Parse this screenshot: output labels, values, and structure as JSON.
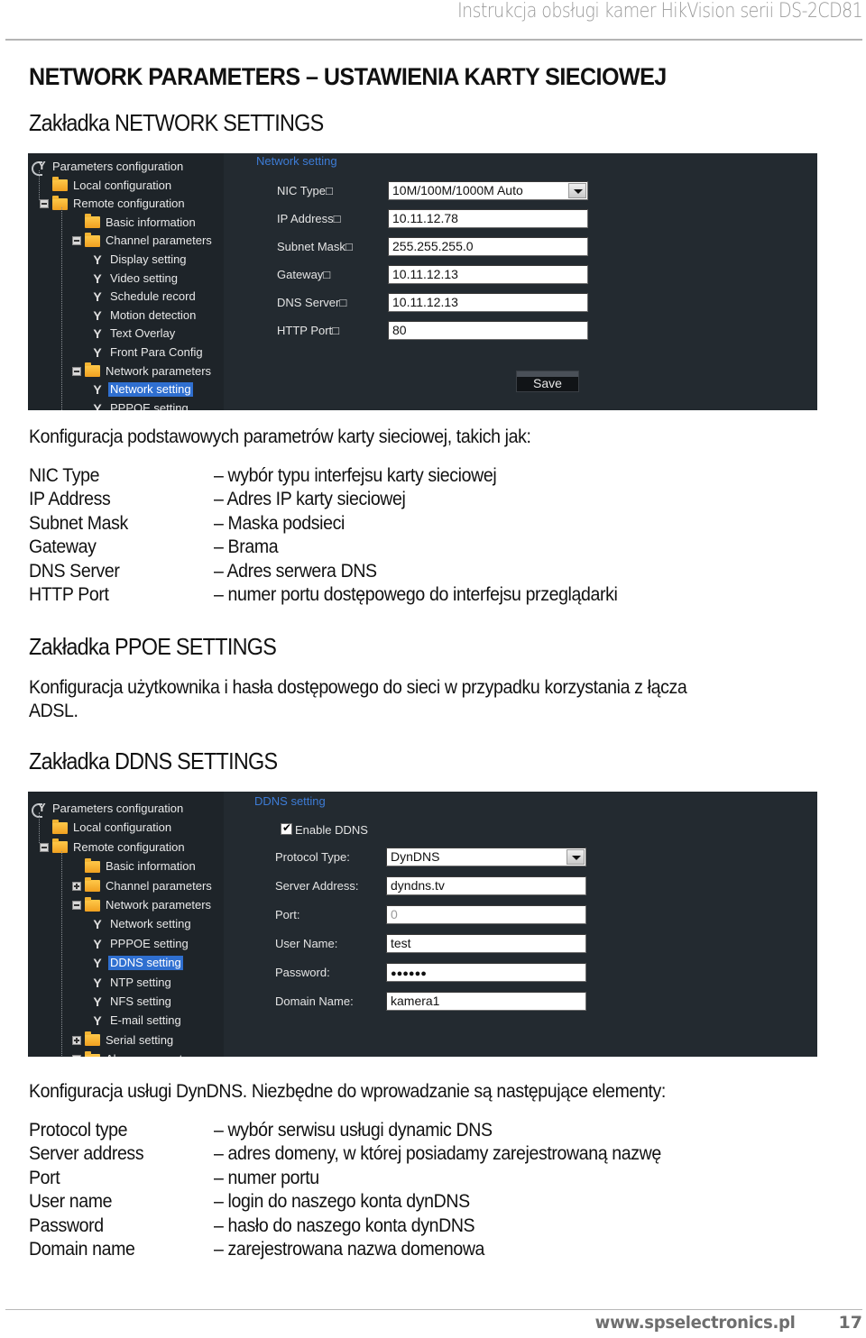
{
  "running_header": "Instrukcja obsługi kamer HikVision serii DS-2CD81",
  "title": "NETWORK PARAMETERS – USTAWIENIA KARTY SIECIOWEJ",
  "network_section": {
    "heading": "Zakładka NETWORK SETTINGS",
    "screenshot": {
      "tree": [
        {
          "label": "Parameters configuration",
          "icon": "root-config-icon",
          "level": 0
        },
        {
          "label": "Local configuration",
          "icon": "folder-icon",
          "level": 1
        },
        {
          "label": "Remote configuration",
          "icon": "folder-icon",
          "level": 1,
          "expander": "collapse"
        },
        {
          "label": "Basic information",
          "icon": "folder-icon",
          "level": 2
        },
        {
          "label": "Channel parameters",
          "icon": "folder-icon",
          "level": 2,
          "expander": "collapse"
        },
        {
          "label": "Display setting",
          "icon": "wrench-icon",
          "level": 3
        },
        {
          "label": "Video setting",
          "icon": "wrench-icon",
          "level": 3
        },
        {
          "label": "Schedule record",
          "icon": "wrench-icon",
          "level": 3
        },
        {
          "label": "Motion detection",
          "icon": "wrench-icon",
          "level": 3
        },
        {
          "label": "Text Overlay",
          "icon": "wrench-icon",
          "level": 3
        },
        {
          "label": "Front Para Config",
          "icon": "wrench-icon",
          "level": 3
        },
        {
          "label": "Network parameters",
          "icon": "folder-icon",
          "level": 2,
          "expander": "collapse"
        },
        {
          "label": "Network setting",
          "icon": "wrench-icon",
          "level": 3,
          "selected": true
        },
        {
          "label": "PPPOE setting",
          "icon": "wrench-icon",
          "level": 3
        }
      ],
      "panel_title": "Network setting",
      "fields": [
        {
          "label": "NIC Type□",
          "value": "10M/100M/1000M Auto",
          "type": "select"
        },
        {
          "label": "IP Address□",
          "value": "10.11.12.78",
          "type": "text"
        },
        {
          "label": "Subnet Mask□",
          "value": "255.255.255.0",
          "type": "text"
        },
        {
          "label": "Gateway□",
          "value": "10.11.12.13",
          "type": "text"
        },
        {
          "label": "DNS Server□",
          "value": "10.11.12.13",
          "type": "text"
        },
        {
          "label": "HTTP Port□",
          "value": "80",
          "type": "text"
        }
      ],
      "save_label": "Save"
    },
    "intro": "Konfiguracja podstawowych parametrów karty sieciowej, takich jak:",
    "definitions": [
      {
        "term": "NIC Type",
        "desc": "– wybór typu interfejsu karty sieciowej"
      },
      {
        "term": "IP Address",
        "desc": "– Adres IP karty sieciowej"
      },
      {
        "term": "Subnet Mask",
        "desc": "– Maska podsieci"
      },
      {
        "term": "Gateway",
        "desc": "– Brama"
      },
      {
        "term": "DNS Server",
        "desc": "– Adres serwera DNS"
      },
      {
        "term": "HTTP Port",
        "desc": "– numer portu dostępowego do interfejsu przeglądarki"
      }
    ]
  },
  "ppoe_section": {
    "heading": "Zakładka PPOE SETTINGS",
    "text_line1": "Konfiguracja użytkownika i hasła dostępowego do sieci w przypadku korzystania z łącza",
    "text_line2": "ADSL."
  },
  "ddns_section": {
    "heading": "Zakładka DDNS SETTINGS",
    "screenshot": {
      "tree": [
        {
          "label": "Parameters configuration",
          "icon": "root-config-icon",
          "level": 0
        },
        {
          "label": "Local configuration",
          "icon": "folder-icon",
          "level": 1
        },
        {
          "label": "Remote configuration",
          "icon": "folder-icon",
          "level": 1,
          "expander": "collapse"
        },
        {
          "label": "Basic information",
          "icon": "folder-icon",
          "level": 2
        },
        {
          "label": "Channel parameters",
          "icon": "folder-icon",
          "level": 2,
          "expander": "expand"
        },
        {
          "label": "Network parameters",
          "icon": "folder-icon",
          "level": 2,
          "expander": "collapse"
        },
        {
          "label": "Network setting",
          "icon": "wrench-icon",
          "level": 3
        },
        {
          "label": "PPPOE setting",
          "icon": "wrench-icon",
          "level": 3
        },
        {
          "label": "DDNS setting",
          "icon": "wrench-icon",
          "level": 3,
          "selected": true
        },
        {
          "label": "NTP setting",
          "icon": "wrench-icon",
          "level": 3
        },
        {
          "label": "NFS setting",
          "icon": "wrench-icon",
          "level": 3
        },
        {
          "label": "E-mail setting",
          "icon": "wrench-icon",
          "level": 3
        },
        {
          "label": "Serial setting",
          "icon": "folder-icon",
          "level": 2,
          "expander": "expand"
        },
        {
          "label": "Alarm parameters",
          "icon": "folder-icon",
          "level": 2,
          "expander": "expand"
        }
      ],
      "panel_title": "DDNS setting",
      "enable_label": "Enable DDNS",
      "enable_checked": true,
      "fields": [
        {
          "label": "Protocol Type:",
          "value": "DynDNS",
          "type": "select"
        },
        {
          "label": "Server Address:",
          "value": "dyndns.tv",
          "type": "text"
        },
        {
          "label": "Port:",
          "value": "0",
          "type": "text",
          "disabled": true
        },
        {
          "label": "User Name:",
          "value": "test",
          "type": "text"
        },
        {
          "label": "Password:",
          "value": "●●●●●●",
          "type": "password"
        },
        {
          "label": "Domain Name:",
          "value": "kamera1",
          "type": "text"
        }
      ]
    },
    "intro": "Konfiguracja usługi DynDNS. Niezbędne do wprowadzanie są następujące elementy:",
    "definitions": [
      {
        "term": "Protocol type",
        "desc": "– wybór serwisu usługi dynamic DNS"
      },
      {
        "term": "Server address",
        "desc": "– adres domeny, w której posiadamy zarejestrowaną nazwę"
      },
      {
        "term": "Port",
        "desc": "– numer portu"
      },
      {
        "term": "User name",
        "desc": "– login do naszego konta dynDNS"
      },
      {
        "term": "Password",
        "desc": "– hasło do naszego konta dynDNS"
      },
      {
        "term": "Domain name",
        "desc": "– zarejestrowana nazwa domenowa"
      }
    ]
  },
  "footer": {
    "url": "www.spselectronics.pl",
    "page_number": "17"
  },
  "colors": {
    "panel_bg": "#232a30",
    "sidebar_bg": "#1e2429",
    "selection": "#2f6fd0",
    "panel_title": "#3d7cd6",
    "folder": "#f0a020"
  }
}
